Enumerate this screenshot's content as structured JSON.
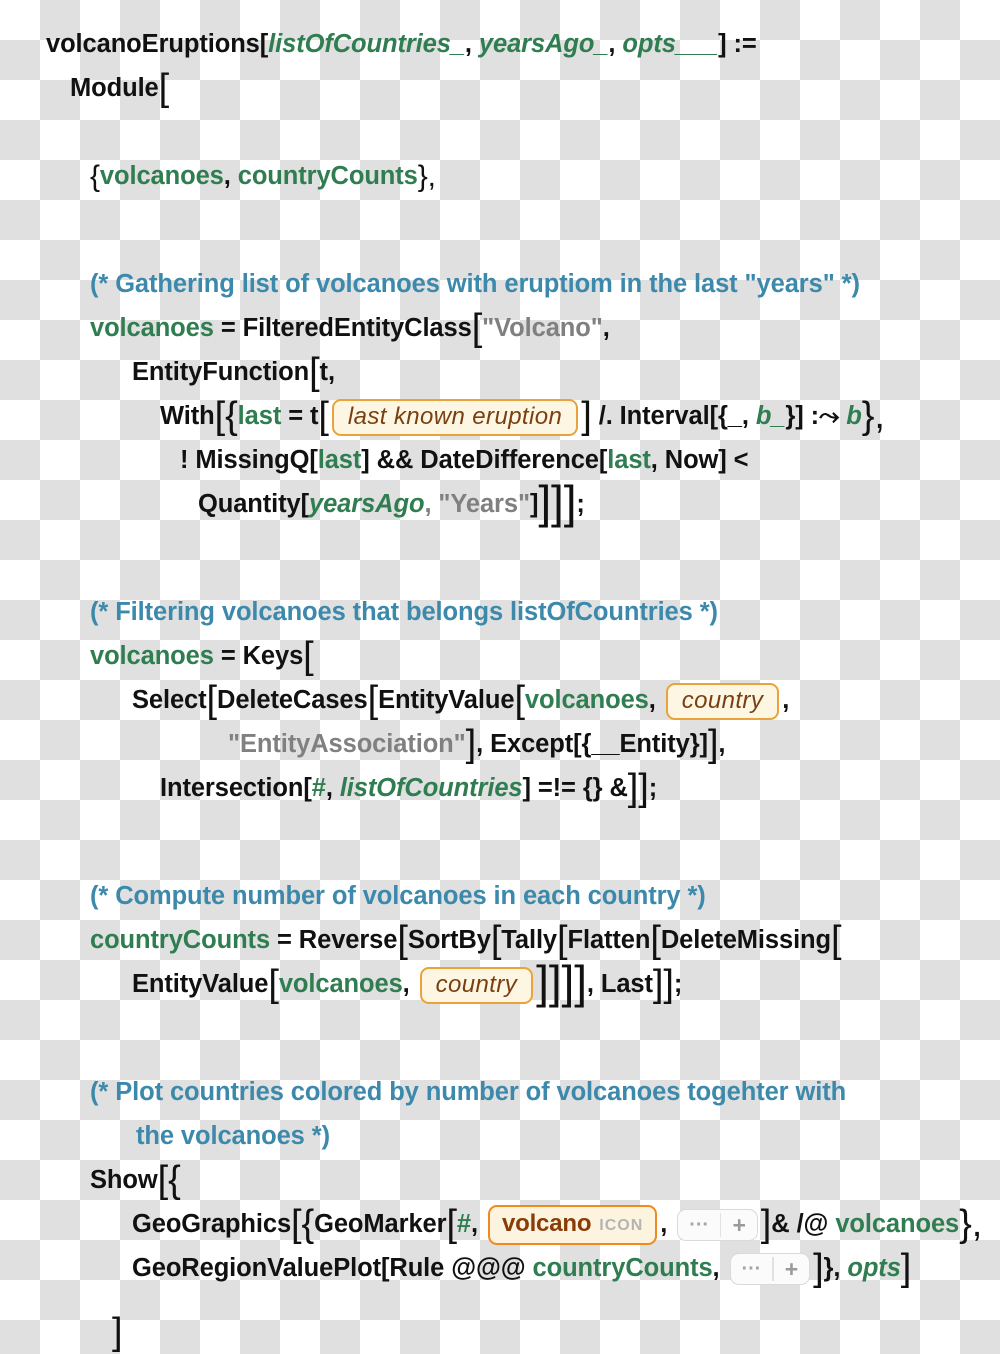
{
  "code": {
    "language": "Wolfram Language",
    "function_name": "volcanoEruptions",
    "lines": {
      "l1_name": "volcanoEruptions[",
      "l1_arg1": "listOfCountries_",
      "l1_c1": ", ",
      "l1_arg2": "yearsAgo_",
      "l1_c2": ", ",
      "l1_arg3": "opts___",
      "l1_close": "] :=",
      "l2_module": "Module",
      "l3_open": "{",
      "l3_v1": "volcanoes",
      "l3_sep": ", ",
      "l3_v2": "countryCounts",
      "l3_close": "},",
      "c1": "(* Gathering list of volcanoes with eruptiom in the last \"years\" *)",
      "l4_var": "volcanoes",
      "l4_eq": " = ",
      "l4_fn": "FilteredEntityClass",
      "l4_str": "\"Volcano\"",
      "l4_comma": ",",
      "l5_fn": "EntityFunction",
      "l5_arg": "t,",
      "l6_with": "With",
      "l6_brace": "{",
      "l6_last": "last",
      "l6_eq": " = t",
      "l6_entity": "last known eruption",
      "l6_repl": "/. Interval[{_, ",
      "l6_b1": "b_",
      "l6_rule": "}] :⤳ ",
      "l6_b2": "b",
      "l6_end": "},",
      "l7": "! MissingQ[",
      "l7_last1": "last",
      "l7_mid": "] && DateDifference[",
      "l7_last2": "last",
      "l7_end": ", Now] <",
      "l8_fn": "Quantity[",
      "l8_arg": "yearsAgo",
      "l8_str": ", \"Years\"",
      "l8_close": "]",
      "l8_semi": ";",
      "c2": "(* Filtering volcanoes that belongs listOfCountries *)",
      "l9_var": "volcanoes",
      "l9_eq": " = ",
      "l9_fn": "Keys",
      "l10_a": "Select",
      "l10_b": "DeleteCases",
      "l10_c": "EntityValue",
      "l10_v": "volcanoes",
      "l10_comma": ", ",
      "l10_entity": "country",
      "l10_tail": ",",
      "l11_str": "\"EntityAssociation\"",
      "l11_mid": ", Except[{__Entity}]",
      "l11_end": ",",
      "l12_fn": "Intersection[",
      "l12_hash": "#",
      "l12_comma": ", ",
      "l12_arg": "listOfCountries",
      "l12_op": "] =!= {} &",
      "l12_semi": ";",
      "c3": "(* Compute number of volcanoes in each country *)",
      "l13_var": "countryCounts",
      "l13_eq": " = ",
      "l13_f1": "Reverse",
      "l13_f2": "SortBy",
      "l13_f3": "Tally",
      "l13_f4": "Flatten",
      "l13_f5": "DeleteMissing",
      "l14_fn": "EntityValue",
      "l14_v": "volcanoes",
      "l14_comma": ", ",
      "l14_entity": "country",
      "l14_mid": ", Last",
      "l14_semi": ";",
      "c4_a": "(* Plot countries colored by number of volcanoes togehter with",
      "c4_b": "the volcanoes *)",
      "l15_show": "Show",
      "l15_brace": "{",
      "l16_geo": "GeoGraphics",
      "l16_brace": "{",
      "l16_marker": "GeoMarker",
      "l16_hash": "#",
      "l16_comma": ", ",
      "l16_icon_name": "volcano",
      "l16_icon_tag": "ICON",
      "l16_map": "& /@ ",
      "l16_var": "volcanoes",
      "l16_end": "},",
      "l17_fn": "GeoRegionValuePlot[Rule @@@ ",
      "l17_var": "countryCounts",
      "l17_comma": ", ",
      "l17_mid": "},",
      "l17_opts": "opts",
      "l18_close": "]"
    },
    "widgets": {
      "ellipsis": "···",
      "plus": "+"
    },
    "colors": {
      "symbol_green": "#2f7d50",
      "comment_teal": "#3c89ab",
      "string_gray": "#808080",
      "entity_border": "#e8a33d",
      "entity_bg": "#fdf6e3",
      "entity_text": "#7a3f10",
      "icon_border": "#f08a1e",
      "icon_text": "#8a3c06",
      "code_black": "#111111"
    }
  }
}
